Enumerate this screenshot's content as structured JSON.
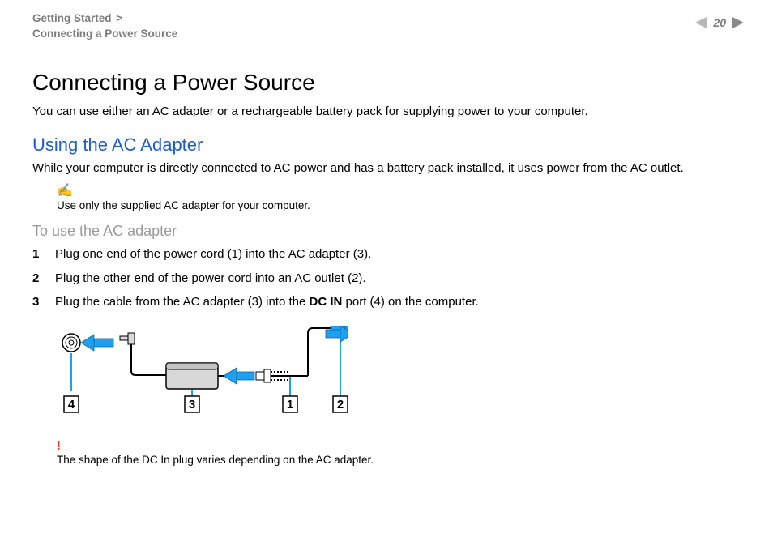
{
  "breadcrumb": {
    "section": "Getting Started",
    "separator": ">",
    "page": "Connecting a Power Source"
  },
  "page_number": "20",
  "title": "Connecting a Power Source",
  "intro": "You can use either an AC adapter or a rechargeable battery pack for supplying power to your computer.",
  "h2": "Using the AC Adapter",
  "h2_body": "While your computer is directly connected to AC power and has a battery pack installed, it uses power from the AC outlet.",
  "note": {
    "icon": "✍",
    "text": "Use only the supplied AC adapter for your computer."
  },
  "h3": "To use the AC adapter",
  "steps": [
    {
      "n": "1",
      "text_a": "Plug one end of the power cord (1) into the AC adapter (3)."
    },
    {
      "n": "2",
      "text_a": "Plug the other end of the power cord into an AC outlet (2)."
    },
    {
      "n": "3",
      "text_a": "Plug the cable from the AC adapter (3) into the ",
      "bold": "DC IN",
      "text_b": " port (4) on the computer."
    }
  ],
  "diagram": {
    "labels": {
      "l4": "4",
      "l3": "3",
      "l1": "1",
      "l2": "2"
    }
  },
  "warning": {
    "icon": "!",
    "text": "The shape of the DC In plug varies depending on the AC adapter."
  }
}
